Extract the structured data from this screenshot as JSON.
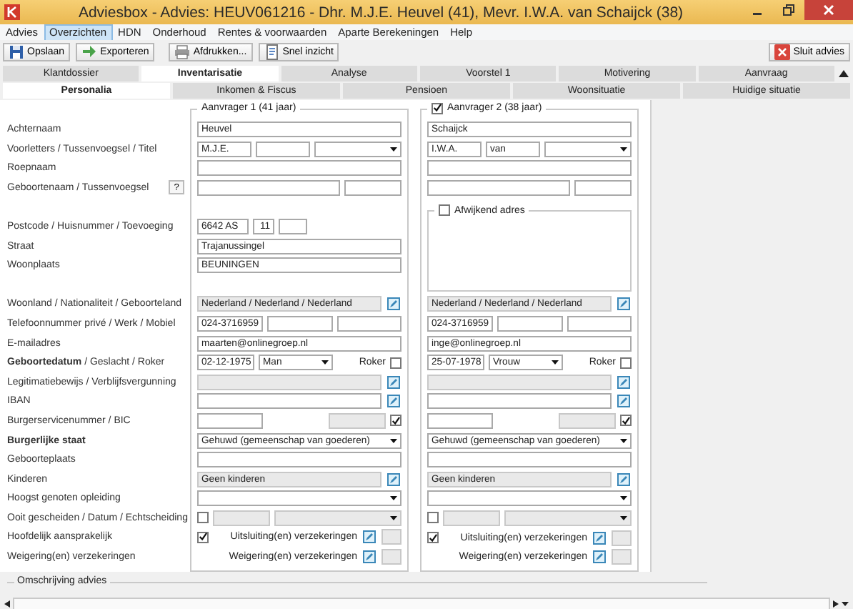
{
  "window": {
    "title": "Adviesbox - Advies: HEUV061216 - Dhr. M.J.E. Heuvel (41), Mevr. I.W.A. van Schaijck (38)"
  },
  "menu": [
    {
      "label": "Advies",
      "selected": false
    },
    {
      "label": "Overzichten",
      "selected": true
    },
    {
      "label": "HDN",
      "selected": false
    },
    {
      "label": "Onderhoud",
      "selected": false
    },
    {
      "label": "Rentes & voorwaarden",
      "selected": false
    },
    {
      "label": "Aparte Berekeningen",
      "selected": false
    },
    {
      "label": "Help",
      "selected": false
    }
  ],
  "toolbar": [
    {
      "label": "Opslaan"
    },
    {
      "label": "Exporteren"
    },
    {
      "label": "Afdrukken..."
    },
    {
      "label": "Snel inzicht"
    }
  ],
  "close_advice_button": {
    "label": "Sluit advies"
  },
  "tabs": [
    {
      "label": "Klantdossier",
      "selected": false
    },
    {
      "label": "Inventarisatie",
      "selected": true
    },
    {
      "label": "Analyse",
      "selected": false
    },
    {
      "label": "Voorstel 1",
      "selected": false
    },
    {
      "label": "Motivering",
      "selected": false
    },
    {
      "label": "Aanvraag",
      "selected": false
    }
  ],
  "subtabs": [
    {
      "label": "Personalia",
      "selected": true
    },
    {
      "label": "Inkomen & Fiscus",
      "selected": false
    },
    {
      "label": "Pensioen",
      "selected": false
    },
    {
      "label": "Woonsituatie",
      "selected": false
    },
    {
      "label": "Huidige situatie",
      "selected": false
    }
  ],
  "applicants": [
    {
      "title": "Aanvrager 1 (41 jaar)"
    },
    {
      "title": "Aanvrager 2 (38 jaar)",
      "checked": true
    }
  ],
  "other_address": {
    "label": "Afwijkend adres",
    "checked": false
  },
  "rows": [
    {
      "kind": "field",
      "label": "Achternaam",
      "bold": false,
      "applicant_1": [
        {
          "kind": "text",
          "value": "Heuvel",
          "disabled": false
        }
      ],
      "applicant_2": [
        {
          "kind": "text",
          "value": "Schaijck",
          "disabled": false
        }
      ]
    },
    {
      "kind": "field",
      "label": "Voorletters / Tussenvoegsel / Titel",
      "bold": false,
      "applicant_1": [
        {
          "kind": "text",
          "value": "M.J.E.",
          "disabled": false
        },
        {
          "kind": "text",
          "disabled": false
        },
        {
          "kind": "select",
          "disabled": false
        }
      ],
      "applicant_2": [
        {
          "kind": "text",
          "value": "I.W.A.",
          "disabled": false
        },
        {
          "kind": "text",
          "value": "van",
          "disabled": false
        },
        {
          "kind": "select",
          "disabled": false
        }
      ]
    },
    {
      "kind": "field",
      "label": "Roepnaam",
      "bold": false,
      "applicant_1": [
        {
          "kind": "text",
          "disabled": false
        }
      ],
      "applicant_2": [
        {
          "kind": "text",
          "disabled": false
        }
      ]
    },
    {
      "kind": "field",
      "label": "Geboortenaam / Tussenvoegsel",
      "bold": false,
      "help": "?",
      "applicant_1": [
        {
          "kind": "text",
          "disabled": false
        },
        {
          "kind": "text",
          "disabled": false
        }
      ],
      "applicant_2": [
        {
          "kind": "text",
          "disabled": false
        },
        {
          "kind": "text",
          "disabled": false
        }
      ]
    },
    {
      "kind": "gap"
    },
    {
      "kind": "field",
      "label": "Postcode / Huisnummer / Toevoeging",
      "bold": false,
      "applicant_1": [
        {
          "kind": "text",
          "value": "6642 AS",
          "disabled": false
        },
        {
          "kind": "number",
          "value": "11",
          "disabled": false
        },
        {
          "kind": "text",
          "disabled": false
        }
      ]
    },
    {
      "kind": "field",
      "label": "Straat",
      "bold": false,
      "applicant_1": [
        {
          "kind": "text",
          "value": "Trajanussingel",
          "disabled": false
        }
      ]
    },
    {
      "kind": "field",
      "label": "Woonplaats",
      "bold": false,
      "applicant_1": [
        {
          "kind": "text",
          "value": "BEUNINGEN",
          "disabled": false
        }
      ]
    },
    {
      "kind": "gap"
    },
    {
      "kind": "field",
      "label": "Woonland / Nationaliteit / Geboorteland",
      "bold": false,
      "applicant_1": [
        {
          "kind": "text",
          "value": "Nederland / Nederland / Nederland",
          "disabled": true
        },
        {
          "kind": "edit"
        }
      ],
      "applicant_2": [
        {
          "kind": "text",
          "value": "Nederland / Nederland / Nederland",
          "disabled": true
        },
        {
          "kind": "edit"
        }
      ]
    },
    {
      "kind": "field",
      "label": "Telefoonnummer privé / Werk / Mobiel",
      "bold": false,
      "applicant_1": [
        {
          "kind": "text",
          "value": "024-3716959",
          "disabled": false
        },
        {
          "kind": "text",
          "disabled": false
        },
        {
          "kind": "text",
          "disabled": false
        }
      ],
      "applicant_2": [
        {
          "kind": "text",
          "value": "024-3716959",
          "disabled": false
        },
        {
          "kind": "text",
          "disabled": false
        },
        {
          "kind": "text",
          "disabled": false
        }
      ]
    },
    {
      "kind": "field",
      "label": "E-mailadres",
      "bold": false,
      "applicant_1": [
        {
          "kind": "text",
          "value": "maarten@onlinegroep.nl",
          "disabled": false
        }
      ],
      "applicant_2": [
        {
          "kind": "text",
          "value": "inge@onlinegroep.nl",
          "disabled": false
        }
      ]
    },
    {
      "kind": "field",
      "label": "**Geboortedatum** / Geslacht / Roker",
      "bold": false,
      "applicant_1": [
        {
          "kind": "text",
          "value": "02-12-1975",
          "disabled": false
        },
        {
          "kind": "select",
          "value": "Man",
          "disabled": false
        },
        {
          "kind": "label",
          "text": "Roker"
        },
        {
          "kind": "checkbox",
          "checked": false
        }
      ],
      "applicant_2": [
        {
          "kind": "text",
          "value": "25-07-1978",
          "disabled": false
        },
        {
          "kind": "select",
          "value": "Vrouw",
          "disabled": false
        },
        {
          "kind": "label",
          "text": "Roker"
        },
        {
          "kind": "checkbox",
          "checked": false
        }
      ]
    },
    {
      "kind": "field",
      "label": "Legitimatiebewijs / Verblijfsvergunning",
      "bold": false,
      "applicant_1": [
        {
          "kind": "text",
          "disabled": true
        },
        {
          "kind": "edit"
        }
      ],
      "applicant_2": [
        {
          "kind": "text",
          "disabled": true
        },
        {
          "kind": "edit"
        }
      ]
    },
    {
      "kind": "field",
      "label": "IBAN",
      "bold": false,
      "applicant_1": [
        {
          "kind": "text",
          "disabled": false
        },
        {
          "kind": "edit"
        }
      ],
      "applicant_2": [
        {
          "kind": "text",
          "disabled": false
        },
        {
          "kind": "edit"
        }
      ]
    },
    {
      "kind": "field",
      "label": "Burgerservicenummer / BIC",
      "bold": false,
      "applicant_1": [
        {
          "kind": "text",
          "disabled": false
        },
        {
          "kind": "text",
          "disabled": true
        },
        {
          "kind": "checkbox",
          "checked": true
        }
      ],
      "applicant_2": [
        {
          "kind": "text",
          "disabled": false
        },
        {
          "kind": "text",
          "disabled": true
        },
        {
          "kind": "checkbox",
          "checked": true
        }
      ]
    },
    {
      "kind": "field",
      "label": "Burgerlijke staat",
      "bold": true,
      "applicant_1": [
        {
          "kind": "select",
          "value": "Gehuwd (gemeenschap van goederen)",
          "disabled": false
        }
      ],
      "applicant_2": [
        {
          "kind": "select",
          "value": "Gehuwd (gemeenschap van goederen)",
          "disabled": false
        }
      ]
    },
    {
      "kind": "field",
      "label": "Geboorteplaats",
      "bold": false,
      "applicant_1": [
        {
          "kind": "text",
          "disabled": false
        }
      ],
      "applicant_2": [
        {
          "kind": "text",
          "disabled": false
        }
      ]
    },
    {
      "kind": "field",
      "label": "Kinderen",
      "bold": false,
      "applicant_1": [
        {
          "kind": "text",
          "value": "Geen kinderen",
          "disabled": true
        },
        {
          "kind": "edit"
        }
      ],
      "applicant_2": [
        {
          "kind": "text",
          "value": "Geen kinderen",
          "disabled": true
        },
        {
          "kind": "edit"
        }
      ]
    },
    {
      "kind": "field",
      "label": "Hoogst genoten opleiding",
      "bold": false,
      "applicant_1": [
        {
          "kind": "select",
          "disabled": false
        }
      ],
      "applicant_2": [
        {
          "kind": "select",
          "disabled": false
        }
      ]
    },
    {
      "kind": "field",
      "label": "Ooit gescheiden / Datum / Echtscheiding",
      "bold": false,
      "applicant_1": [
        {
          "kind": "checkbox",
          "checked": false
        },
        {
          "kind": "text",
          "disabled": true
        },
        {
          "kind": "select",
          "disabled": true
        }
      ],
      "applicant_2": [
        {
          "kind": "checkbox",
          "checked": false
        },
        {
          "kind": "text",
          "disabled": true
        },
        {
          "kind": "select",
          "disabled": true
        }
      ]
    },
    {
      "kind": "field",
      "label": "Hoofdelijk aansprakelijk",
      "bold": false,
      "applicant_1": [
        {
          "kind": "checkbox",
          "checked": true
        },
        {
          "kind": "label",
          "text": "Uitsluiting(en) verzekeringen"
        },
        {
          "kind": "edit"
        },
        {
          "kind": "text",
          "disabled": true
        }
      ],
      "applicant_2": [
        {
          "kind": "checkbox",
          "checked": true
        },
        {
          "kind": "label",
          "text": "Uitsluiting(en) verzekeringen"
        },
        {
          "kind": "edit"
        },
        {
          "kind": "text",
          "disabled": true
        }
      ]
    },
    {
      "kind": "field",
      "label": "Weigering(en) verzekeringen",
      "bold": false,
      "applicant_1": [
        {
          "kind": "label",
          "text": "Weigering(en) verzekeringen"
        },
        {
          "kind": "edit"
        },
        {
          "kind": "text",
          "disabled": true
        }
      ],
      "applicant_2": [
        {
          "kind": "label",
          "text": "Weigering(en) verzekeringen"
        },
        {
          "kind": "edit"
        },
        {
          "kind": "text",
          "disabled": true
        }
      ]
    }
  ],
  "description": {
    "title": "Omschrijving advies"
  }
}
